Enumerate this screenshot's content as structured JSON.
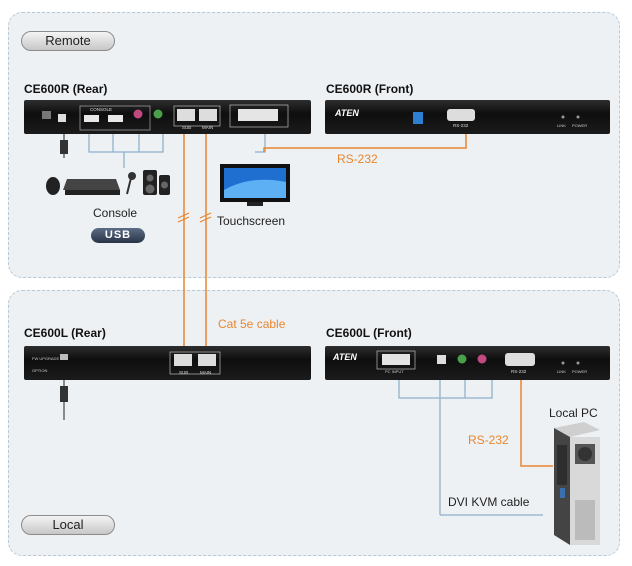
{
  "sections": {
    "remote": "Remote",
    "local": "Local"
  },
  "devices": {
    "ce600r_rear": "CE600R (Rear)",
    "ce600r_front": "CE600R (Front)",
    "ce600l_rear": "CE600L (Rear)",
    "ce600l_front": "CE600L (Front)"
  },
  "labels": {
    "console": "Console",
    "usb": "USB",
    "touchscreen": "Touchscreen",
    "rs232_top": "RS-232",
    "cat5e": "Cat 5e cable",
    "local_pc": "Local PC",
    "rs232_bottom": "RS-232",
    "dvi_kvm": "DVI KVM cable"
  },
  "panel_text": {
    "console": "CONSOLE",
    "sub": "SUB",
    "main": "MAIN",
    "aten": "ATEN",
    "rs232_port": "RS-232",
    "link": "LINK",
    "power": "POWER",
    "pc_input": "PC INPUT",
    "upgrade": "FW UPGRADE",
    "option": "OPTION"
  },
  "colors": {
    "orange": "#e8862e",
    "blue_line": "#8fb1c9",
    "panel_bg": "#eef1f4"
  }
}
